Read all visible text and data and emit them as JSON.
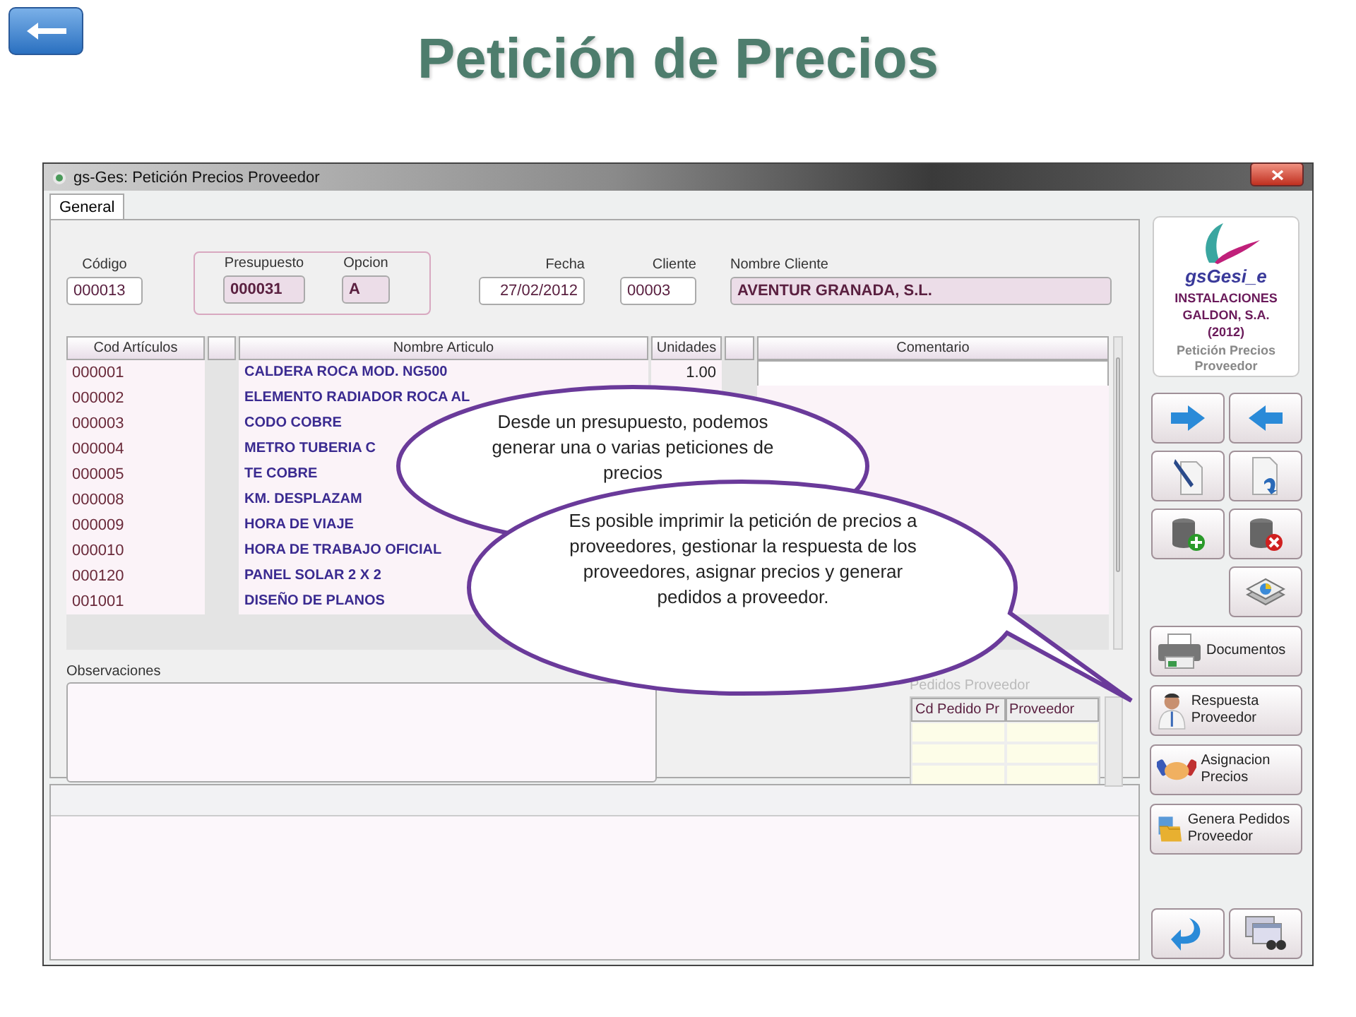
{
  "slide": {
    "title": "Petición de Precios"
  },
  "window": {
    "title": "gs-Ges: Petición Precios Proveedor"
  },
  "tabs": [
    {
      "label": "General",
      "selected": true
    }
  ],
  "header": {
    "codigo": {
      "label": "Código",
      "value": "000013"
    },
    "presupuesto_group": [
      {
        "label": "Presupuesto",
        "value": "000031"
      },
      {
        "label": "Opcion",
        "value": "A"
      }
    ],
    "fecha": {
      "label": "Fecha",
      "value": "27/02/2012"
    },
    "cliente": {
      "label": "Cliente",
      "value": "00003"
    },
    "nombre_cliente": {
      "label": "Nombre Cliente",
      "value": "AVENTUR GRANADA, S.L."
    }
  },
  "table": {
    "columns": [
      "Cod Artículos",
      "Nombre Articulo",
      "Unidades",
      "Comentario"
    ],
    "rows": [
      {
        "code": "000001",
        "name": "CALDERA ROCA MOD. NG500",
        "units": "1.00",
        "selected": true
      },
      {
        "code": "000002",
        "name": "ELEMENTO RADIADOR  ROCA AL",
        "selected": false
      },
      {
        "code": "000003",
        "name": "CODO COBRE",
        "selected": false
      },
      {
        "code": "000004",
        "name": "METRO TUBERIA C",
        "selected": false
      },
      {
        "code": "000005",
        "name": "TE COBRE",
        "selected": false
      },
      {
        "code": "000008",
        "name": "KM. DESPLAZAM",
        "selected": false
      },
      {
        "code": "000009",
        "name": "HORA DE VIAJE",
        "selected": false
      },
      {
        "code": "000010",
        "name": "HORA DE TRABAJO OFICIAL",
        "selected": false
      },
      {
        "code": "000120",
        "name": "PANEL SOLAR 2 X 2",
        "selected": false
      },
      {
        "code": "001001",
        "name": "DISEÑO DE PLANOS",
        "selected": false
      }
    ]
  },
  "observaciones": {
    "label": "Observaciones"
  },
  "pedidos_proveedor": {
    "label": "Pedidos Proveedor",
    "columns": [
      "Cd Pedido Pr",
      "Proveedor"
    ]
  },
  "sidebar": {
    "logo": {
      "brand": "gsGesi_e",
      "company": "INSTALACIONES GALDON, S.A. (2012)",
      "module": "Petición Precios Proveedor"
    },
    "buttons": [
      {
        "label": "Documentos",
        "kind": "printer"
      },
      {
        "label": "Respuesta Proveedor",
        "kind": "person"
      },
      {
        "label": "Asignacion Precios",
        "kind": "handshake"
      },
      {
        "label": "Genera Pedidos Proveedor",
        "kind": "folder"
      }
    ]
  },
  "callouts": [
    {
      "text": "Desde  un presupuesto, podemos generar una o varias peticiones de precios"
    },
    {
      "text": "Es posible imprimir la petición de precios a proveedores, gestionar la respuesta de los proveedores, asignar precios y generar pedidos a proveedor."
    }
  ]
}
